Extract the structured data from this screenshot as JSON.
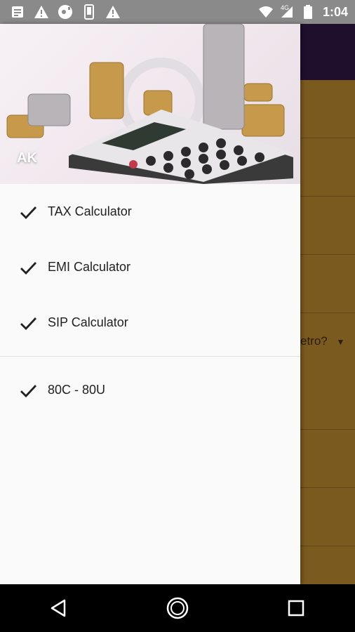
{
  "status_bar": {
    "time": "1:04",
    "network": "4G",
    "icons_left": [
      "notes-icon",
      "warning-icon",
      "media-icon",
      "phone-icon",
      "warning-icon"
    ],
    "icons_right": [
      "wifi-icon",
      "signal-icon",
      "battery-icon"
    ]
  },
  "drawer": {
    "header_label": "AK",
    "items": [
      {
        "label": "TAX Calculator",
        "icon": "check-icon"
      },
      {
        "label": "EMI Calculator",
        "icon": "check-icon"
      },
      {
        "label": "SIP Calculator",
        "icon": "check-icon"
      }
    ],
    "section2_items": [
      {
        "label": "80C - 80U",
        "icon": "check-icon"
      }
    ]
  },
  "background": {
    "dropdown_text": "etro?",
    "toolbar_color": "#1f0f2d",
    "content_color": "#7b5a20"
  },
  "navigation_bar": {
    "buttons": [
      "back-icon",
      "home-icon",
      "recents-icon"
    ]
  }
}
